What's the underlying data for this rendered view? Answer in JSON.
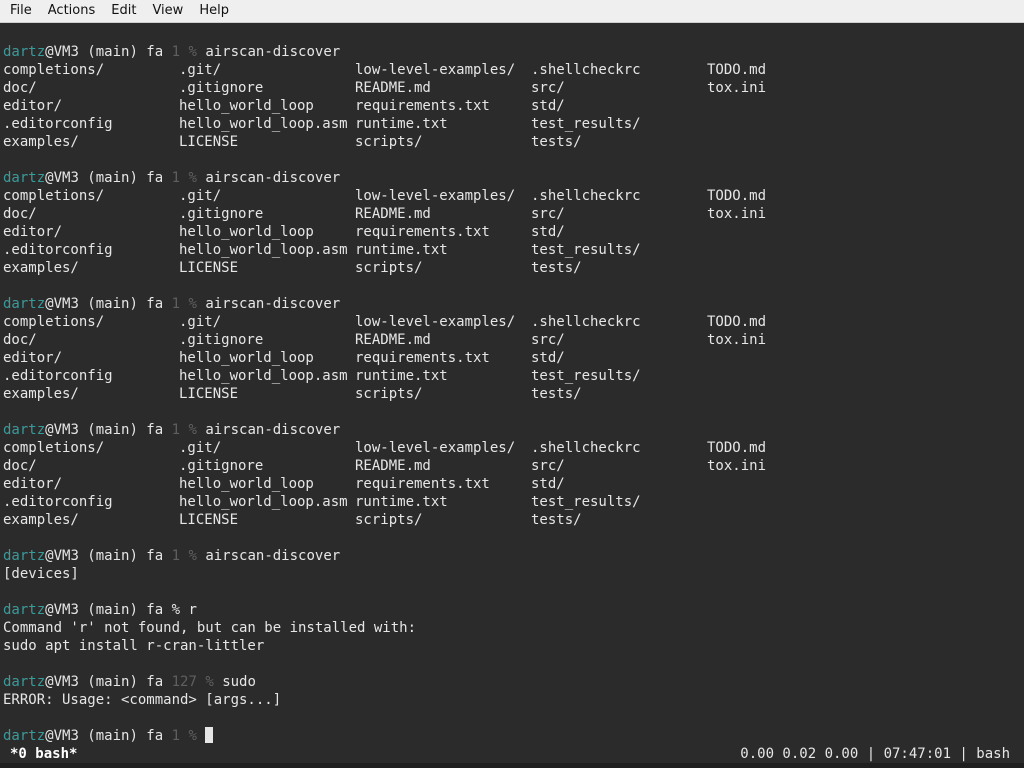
{
  "menubar": {
    "items": [
      "File",
      "Actions",
      "Edit",
      "View",
      "Help"
    ]
  },
  "terminal": {
    "blocks": [
      {
        "prompt": {
          "user": "dartz",
          "host": "@VM3 (main) fa ",
          "code": "1",
          "sign": " % ",
          "cmd": "airscan-discover"
        },
        "listing": [
          [
            "completions/",
            ".git/",
            "low-level-examples/",
            ".shellcheckrc",
            "TODO.md"
          ],
          [
            "doc/",
            ".gitignore",
            "README.md",
            "src/",
            "tox.ini"
          ],
          [
            "editor/",
            "hello_world_loop",
            "requirements.txt",
            "std/",
            ""
          ],
          [
            ".editorconfig",
            "hello_world_loop.asm",
            "runtime.txt",
            "test_results/",
            ""
          ],
          [
            "examples/",
            "LICENSE",
            "scripts/",
            "tests/",
            ""
          ]
        ]
      },
      {
        "prompt": {
          "user": "dartz",
          "host": "@VM3 (main) fa ",
          "code": "1",
          "sign": " % ",
          "cmd": "airscan-discover"
        },
        "listing": [
          [
            "completions/",
            ".git/",
            "low-level-examples/",
            ".shellcheckrc",
            "TODO.md"
          ],
          [
            "doc/",
            ".gitignore",
            "README.md",
            "src/",
            "tox.ini"
          ],
          [
            "editor/",
            "hello_world_loop",
            "requirements.txt",
            "std/",
            ""
          ],
          [
            ".editorconfig",
            "hello_world_loop.asm",
            "runtime.txt",
            "test_results/",
            ""
          ],
          [
            "examples/",
            "LICENSE",
            "scripts/",
            "tests/",
            ""
          ]
        ]
      },
      {
        "prompt": {
          "user": "dartz",
          "host": "@VM3 (main) fa ",
          "code": "1",
          "sign": " % ",
          "cmd": "airscan-discover"
        },
        "listing": [
          [
            "completions/",
            ".git/",
            "low-level-examples/",
            ".shellcheckrc",
            "TODO.md"
          ],
          [
            "doc/",
            ".gitignore",
            "README.md",
            "src/",
            "tox.ini"
          ],
          [
            "editor/",
            "hello_world_loop",
            "requirements.txt",
            "std/",
            ""
          ],
          [
            ".editorconfig",
            "hello_world_loop.asm",
            "runtime.txt",
            "test_results/",
            ""
          ],
          [
            "examples/",
            "LICENSE",
            "scripts/",
            "tests/",
            ""
          ]
        ]
      },
      {
        "prompt": {
          "user": "dartz",
          "host": "@VM3 (main) fa ",
          "code": "1",
          "sign": " % ",
          "cmd": "airscan-discover"
        },
        "listing": [
          [
            "completions/",
            ".git/",
            "low-level-examples/",
            ".shellcheckrc",
            "TODO.md"
          ],
          [
            "doc/",
            ".gitignore",
            "README.md",
            "src/",
            "tox.ini"
          ],
          [
            "editor/",
            "hello_world_loop",
            "requirements.txt",
            "std/",
            ""
          ],
          [
            ".editorconfig",
            "hello_world_loop.asm",
            "runtime.txt",
            "test_results/",
            ""
          ],
          [
            "examples/",
            "LICENSE",
            "scripts/",
            "tests/",
            ""
          ]
        ]
      },
      {
        "prompt": {
          "user": "dartz",
          "host": "@VM3 (main) fa ",
          "code": "1",
          "sign": " % ",
          "cmd": "airscan-discover"
        },
        "output": [
          "[devices]"
        ]
      },
      {
        "prompt": {
          "user": "dartz",
          "host": "@VM3 (main) fa ",
          "code": "",
          "sign": "% ",
          "cmd": "r"
        },
        "output": [
          "Command 'r' not found, but can be installed with:",
          "sudo apt install r-cran-littler"
        ]
      },
      {
        "prompt": {
          "user": "dartz",
          "host": "@VM3 (main) fa ",
          "code": "127",
          "sign": " % ",
          "cmd": "sudo"
        },
        "output": [
          "ERROR: Usage: <command> [args...]"
        ]
      }
    ],
    "current_prompt": {
      "user": "dartz",
      "host": "@VM3 (main) fa ",
      "code": "1",
      "sign": " % "
    }
  },
  "statusbar": {
    "left": "*0 bash*",
    "right": "0.00 0.02 0.00 | 07:47:01 | bash"
  },
  "colors": {
    "background": "#2b2b2b",
    "user": "#3a9b9b",
    "text": "#e6e6e6",
    "dim": "#5f5f5f"
  }
}
